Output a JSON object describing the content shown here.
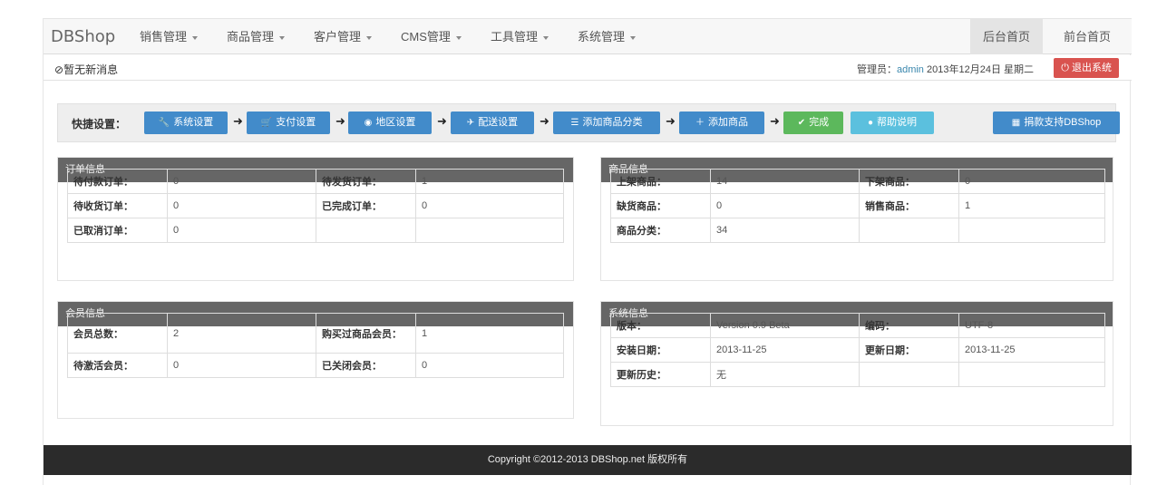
{
  "brand": "DBShop",
  "menu": [
    {
      "label": "销售管理"
    },
    {
      "label": "商品管理"
    },
    {
      "label": "客户管理"
    },
    {
      "label": "CMS管理"
    },
    {
      "label": "工具管理"
    },
    {
      "label": "系统管理"
    }
  ],
  "nav_right": {
    "backend_home": "后台首页",
    "frontend_home": "前台首页"
  },
  "subbar": {
    "message": "暂无新消息",
    "admin_prefix": "管理员：",
    "admin_name": "admin",
    "date": "2013年12月24日 星期二",
    "logout": "退出系统"
  },
  "quick": {
    "label": "快捷设置：",
    "buttons": [
      {
        "label": "系统设置",
        "icon": "wrench-icon"
      },
      {
        "label": "支付设置",
        "icon": "cart-icon"
      },
      {
        "label": "地区设置",
        "icon": "globe-icon"
      },
      {
        "label": "配送设置",
        "icon": "plane-icon"
      },
      {
        "label": "添加商品分类",
        "icon": "list-icon"
      },
      {
        "label": "添加商品",
        "icon": "plus-icon"
      },
      {
        "label": "完成",
        "icon": "check-icon"
      },
      {
        "label": "帮助说明",
        "icon": "info-icon"
      }
    ],
    "donate": "捐款支持DBShop"
  },
  "orders": {
    "title": "订单信息",
    "rows": [
      [
        "待付款订单：",
        "0",
        "待发货订单：",
        "1"
      ],
      [
        "待收货订单：",
        "0",
        "已完成订单：",
        "0"
      ],
      [
        "已取消订单：",
        "0",
        "",
        ""
      ]
    ]
  },
  "goods": {
    "title": "商品信息",
    "rows": [
      [
        "上架商品：",
        "14",
        "下架商品：",
        "0"
      ],
      [
        "缺货商品：",
        "0",
        "销售商品：",
        "1"
      ],
      [
        "商品分类：",
        "34",
        "",
        ""
      ]
    ]
  },
  "members": {
    "title": "会员信息",
    "rows": [
      [
        "会员总数：",
        "2",
        "购买过商品会员：",
        "1"
      ],
      [
        "待激活会员：",
        "0",
        "已关闭会员：",
        "0"
      ]
    ]
  },
  "system": {
    "title": "系统信息",
    "rows": [
      [
        "版本：",
        "Version 0.9 Beta",
        "编码：",
        "UTF-8"
      ],
      [
        "安装日期：",
        "2013-11-25",
        "更新日期：",
        "2013-11-25"
      ],
      [
        "更新历史：",
        "无",
        "",
        ""
      ]
    ]
  },
  "footer": "Copyright ©2012-2013 DBShop.net 版权所有",
  "colors": {
    "primary": "#428bca",
    "success": "#5cb85c",
    "info": "#5bc0de",
    "danger": "#d9534f",
    "panel_head": "#666666",
    "footer": "#2b2b2b"
  }
}
